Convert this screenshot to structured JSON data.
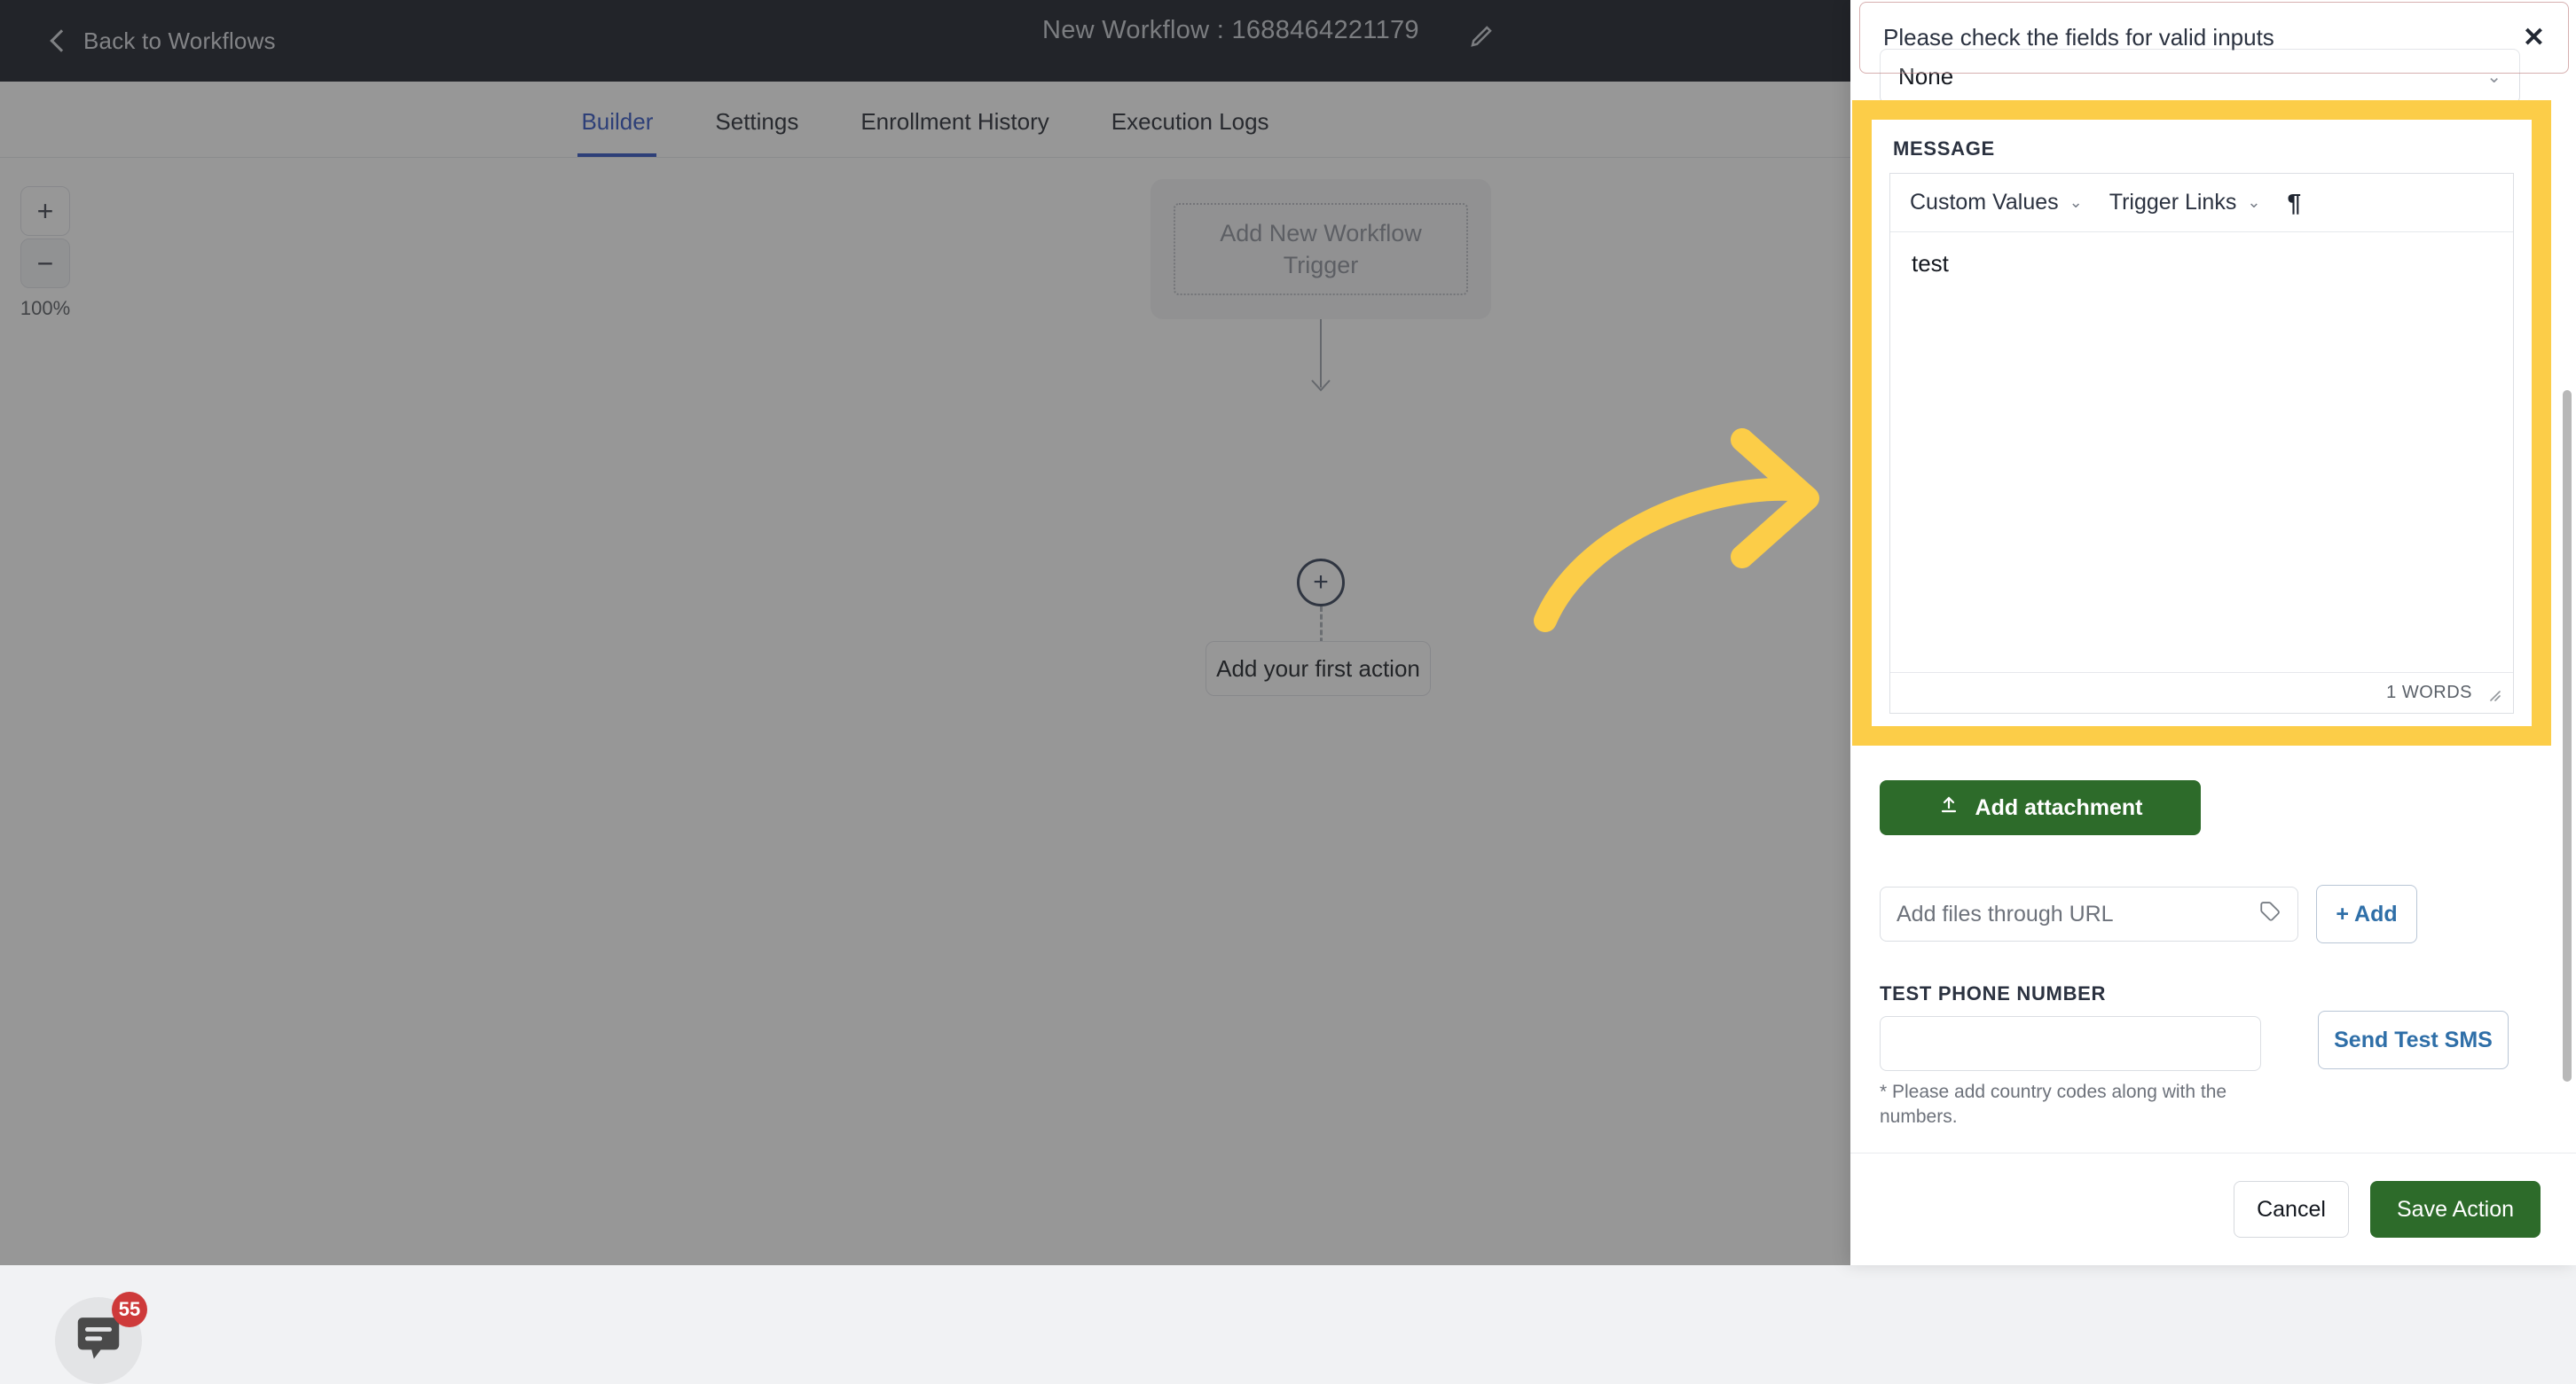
{
  "topbar": {
    "back_label": "Back to Workflows",
    "workflow_title": "New Workflow : 1688464221179",
    "edit_icon": "pencil-icon"
  },
  "tabs": [
    {
      "label": "Builder",
      "active": true
    },
    {
      "label": "Settings",
      "active": false
    },
    {
      "label": "Enrollment History",
      "active": false
    },
    {
      "label": "Execution Logs",
      "active": false
    }
  ],
  "canvas": {
    "zoom_in_label": "+",
    "zoom_out_label": "−",
    "zoom_level": "100%",
    "trigger_node_label": "Add New Workflow Trigger",
    "plus_node_label": "+",
    "first_action_label": "Add your first action"
  },
  "chat_widget": {
    "badge_count": "55",
    "icon": "chat-bubble-icon"
  },
  "toast": {
    "message": "Please check the fields for valid inputs",
    "close_label": "✕"
  },
  "panel": {
    "select_value": "None",
    "select_caret": "⌄",
    "message_section_label": "MESSAGE",
    "editor": {
      "custom_values_label": "Custom Values",
      "trigger_links_label": "Trigger Links",
      "pilcrow_label": "¶",
      "caret": "⌄",
      "body_text": "test",
      "word_count": "1 WORDS"
    },
    "add_attachment_label": "Add attachment",
    "upload_icon": "upload-icon",
    "url_placeholder": "Add files through URL",
    "url_value": "",
    "tag_icon": "tag-icon",
    "add_button_label": "+ Add",
    "test_phone_label": "TEST PHONE NUMBER",
    "test_phone_value": "",
    "test_phone_hint": "* Please add country codes along with the numbers.",
    "send_test_sms_label": "Send Test SMS",
    "cancel_label": "Cancel",
    "save_label": "Save Action"
  },
  "colors": {
    "highlight": "#fccd48",
    "arrow": "#fccd48",
    "accent_blue": "#2a4ec0",
    "green": "#2d6b2a",
    "badge_red": "#ce3a3a",
    "topbar_dark": "#141823"
  }
}
